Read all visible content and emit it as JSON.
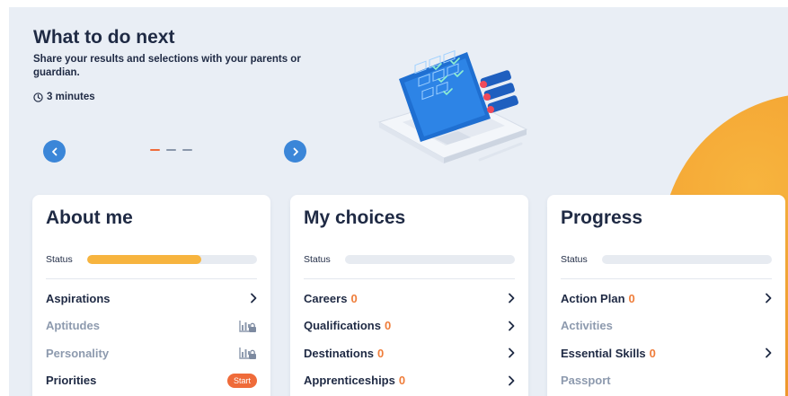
{
  "hero": {
    "title": "What to do next",
    "description": "Share your results and selections with your parents or guardian.",
    "duration": "3 minutes",
    "slides_total": 3,
    "active_slide": 1
  },
  "cards": {
    "about_me": {
      "title": "About me",
      "status_label": "Status",
      "progress_percent": 67,
      "items": [
        {
          "label": "Aspirations",
          "state": "open"
        },
        {
          "label": "Aptitudes",
          "state": "locked"
        },
        {
          "label": "Personality",
          "state": "locked"
        },
        {
          "label": "Priorities",
          "state": "start",
          "badge": "Start"
        }
      ]
    },
    "my_choices": {
      "title": "My choices",
      "status_label": "Status",
      "progress_percent": 0,
      "items": [
        {
          "label": "Careers",
          "count": "0"
        },
        {
          "label": "Qualifications",
          "count": "0"
        },
        {
          "label": "Destinations",
          "count": "0"
        },
        {
          "label": "Apprenticeships",
          "count": "0"
        }
      ]
    },
    "progress": {
      "title": "Progress",
      "status_label": "Status",
      "progress_percent": 0,
      "items": [
        {
          "label": "Action Plan",
          "count": "0"
        },
        {
          "label": "Activities"
        },
        {
          "label": "Essential Skills",
          "count": "0"
        },
        {
          "label": "Passport"
        }
      ]
    }
  },
  "colors": {
    "accent_orange": "#ef6b3a",
    "progress_yellow": "#f7b43e",
    "nav_blue": "#3b86d8",
    "background": "#e9eef5"
  }
}
